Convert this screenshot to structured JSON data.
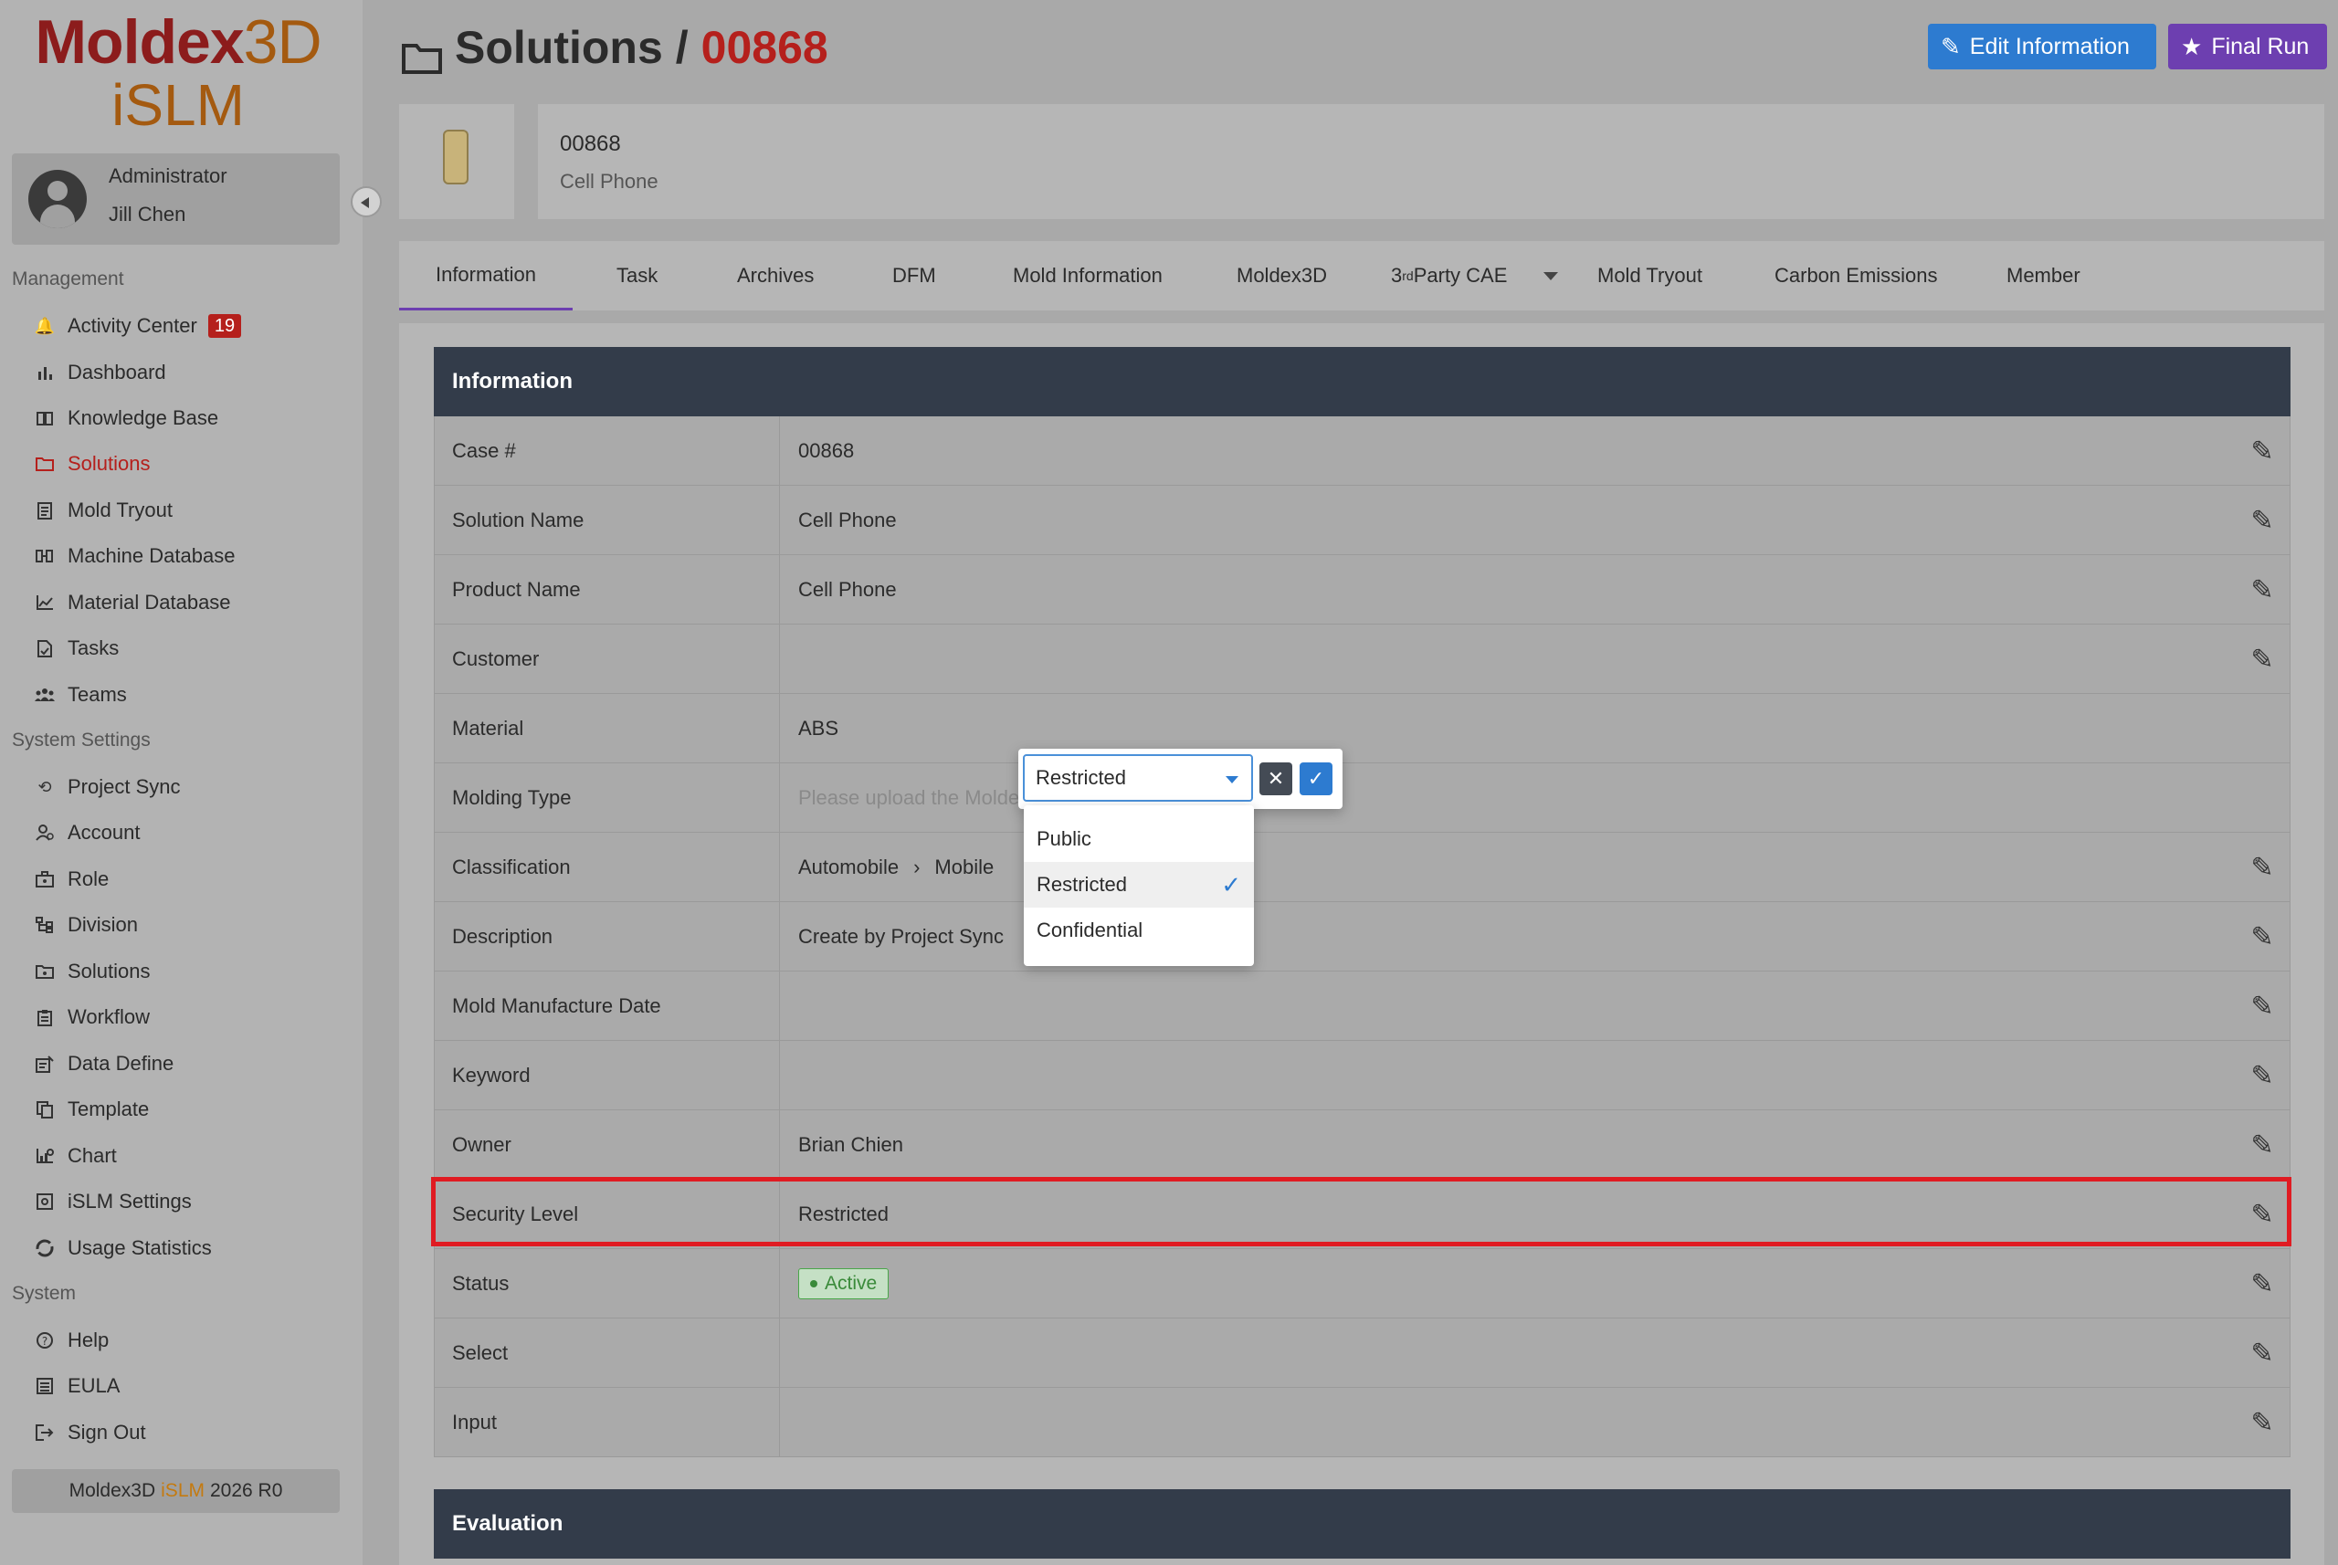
{
  "app": {
    "logo_top_a": "Moldex",
    "logo_top_b": "3D",
    "logo_bottom": "iSLM"
  },
  "user": {
    "role": "Administrator",
    "name": "Jill Chen"
  },
  "sidebar": {
    "sections": {
      "management": "Management",
      "system_settings": "System Settings",
      "system": "System"
    },
    "management_items": [
      {
        "label": "Activity Center",
        "icon": "bell-icon",
        "badge": "19"
      },
      {
        "label": "Dashboard",
        "icon": "bar-chart-icon"
      },
      {
        "label": "Knowledge Base",
        "icon": "book-icon"
      },
      {
        "label": "Solutions",
        "icon": "folder-icon",
        "active": true
      },
      {
        "label": "Mold Tryout",
        "icon": "document-icon"
      },
      {
        "label": "Machine Database",
        "icon": "machine-icon"
      },
      {
        "label": "Material Database",
        "icon": "line-chart-icon"
      },
      {
        "label": "Tasks",
        "icon": "task-icon"
      },
      {
        "label": "Teams",
        "icon": "team-icon"
      }
    ],
    "settings_items": [
      {
        "label": "Project Sync",
        "icon": "sync-icon"
      },
      {
        "label": "Account",
        "icon": "account-icon"
      },
      {
        "label": "Role",
        "icon": "role-icon"
      },
      {
        "label": "Division",
        "icon": "division-icon"
      },
      {
        "label": "Solutions",
        "icon": "solutions-settings-icon"
      },
      {
        "label": "Workflow",
        "icon": "workflow-icon"
      },
      {
        "label": "Data Define",
        "icon": "data-define-icon"
      },
      {
        "label": "Template",
        "icon": "template-icon"
      },
      {
        "label": "Chart",
        "icon": "chart-icon"
      },
      {
        "label": "iSLM Settings",
        "icon": "settings-icon"
      },
      {
        "label": "Usage Statistics",
        "icon": "statistics-icon"
      }
    ],
    "system_items": [
      {
        "label": "Help",
        "icon": "help-icon"
      },
      {
        "label": "EULA",
        "icon": "eula-icon"
      },
      {
        "label": "Sign Out",
        "icon": "sign-out-icon"
      }
    ],
    "version_prefix": "Moldex3D",
    "version_mid": "iSLM",
    "version_suffix": "2026 R0"
  },
  "header": {
    "section": "Solutions",
    "separator": "/",
    "case_id": "00868",
    "edit_button": "Edit Information",
    "final_button": "Final Run"
  },
  "product": {
    "id": "00868",
    "name": "Cell Phone"
  },
  "tabs": [
    {
      "label": "Information",
      "active": true
    },
    {
      "label": "Task"
    },
    {
      "label": "Archives"
    },
    {
      "label": "DFM"
    },
    {
      "label": "Mold Information"
    },
    {
      "label": "Moldex3D"
    },
    {
      "label_pre": "3",
      "label_sup": "rd",
      "label_post": " Party CAE"
    },
    {
      "label": "Mold Tryout"
    },
    {
      "label": "Carbon Emissions"
    },
    {
      "label": "Member"
    }
  ],
  "information": {
    "title": "Information",
    "rows": [
      {
        "label": "Case #",
        "value": "00868"
      },
      {
        "label": "Solution Name",
        "value": "Cell Phone"
      },
      {
        "label": "Product Name",
        "value": "Cell Phone"
      },
      {
        "label": "Customer",
        "value": ""
      },
      {
        "label": "Material",
        "value": "ABS"
      },
      {
        "label": "Molding Type",
        "value": "Please upload the Molde"
      },
      {
        "label": "Classification",
        "value_a": "Automobile",
        "value_b": "Mobile"
      },
      {
        "label": "Description",
        "value": "Create by Project Sync"
      },
      {
        "label": "Mold Manufacture Date",
        "value": ""
      },
      {
        "label": "Keyword",
        "value": ""
      },
      {
        "label": "Owner",
        "value": "Brian Chien"
      },
      {
        "label": "Security Level",
        "value": "Restricted"
      },
      {
        "label": "Status",
        "value": "Active"
      },
      {
        "label": "Select",
        "value": ""
      },
      {
        "label": "Input",
        "value": ""
      }
    ]
  },
  "evaluation": {
    "title": "Evaluation"
  },
  "security_dropdown": {
    "selected": "Restricted",
    "options": [
      "Public",
      "Restricted",
      "Confidential"
    ]
  },
  "colors": {
    "accent_red": "#b5201c",
    "brand_orange": "#a45a10",
    "edit_blue": "#2d7bd0",
    "final_purple": "#6d3fb0",
    "highlight_red": "#e01b22",
    "status_green": "#3a8a3a"
  }
}
